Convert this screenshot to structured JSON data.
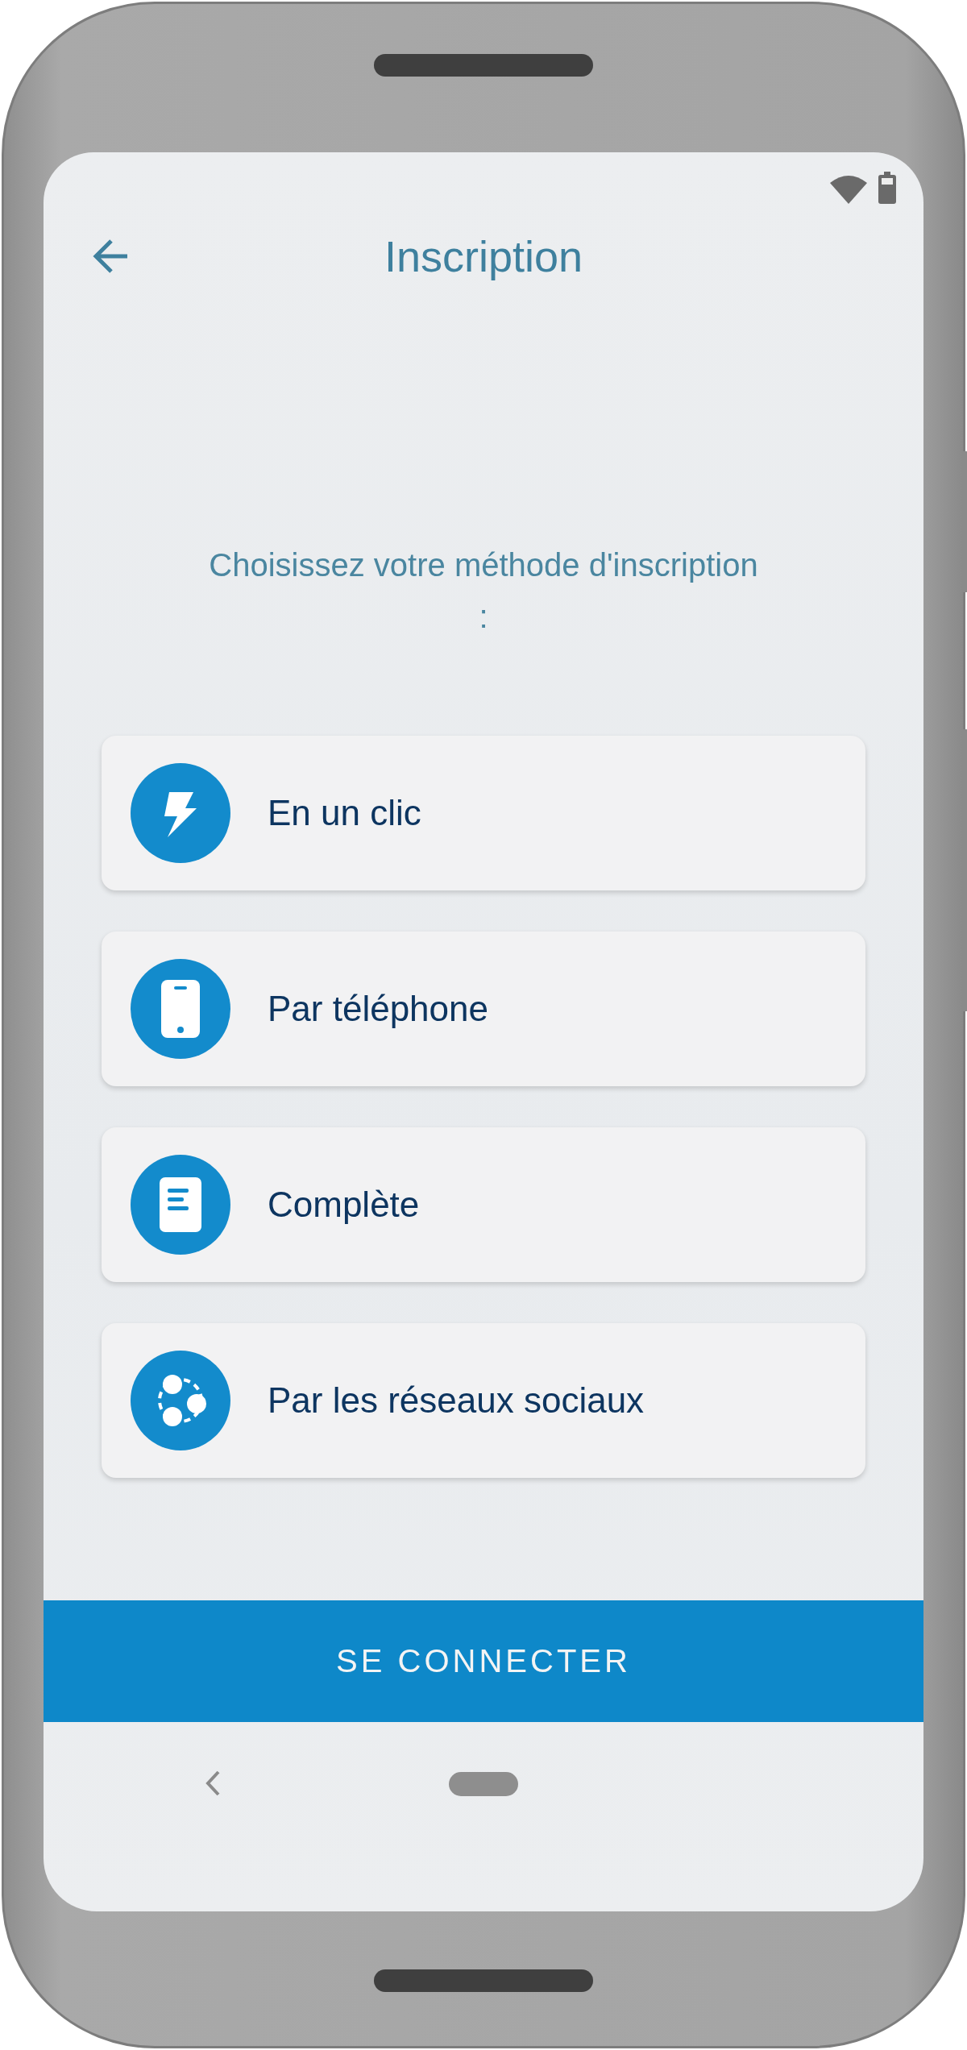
{
  "header": {
    "title": "Inscription"
  },
  "prompt": "Choisissez votre méthode d'inscription :",
  "methods": [
    {
      "kind": "bolt",
      "label": "En un clic"
    },
    {
      "kind": "phone",
      "label": "Par téléphone"
    },
    {
      "kind": "document",
      "label": "Complète"
    },
    {
      "kind": "social",
      "label": "Par les réseaux sociaux"
    }
  ],
  "login_button": "SE CONNECTER"
}
